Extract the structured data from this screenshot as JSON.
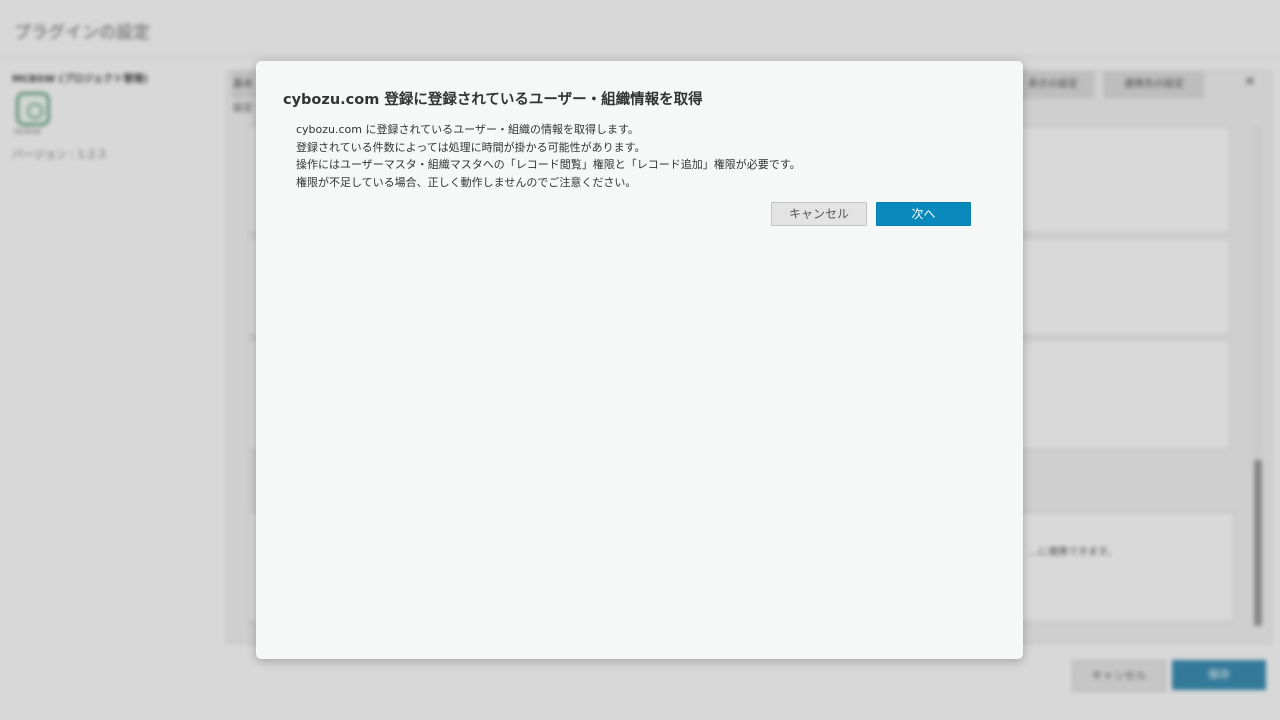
{
  "background": {
    "page_title": "プラグインの設定",
    "plugin_name": "MCBSW (プロジェクト管理)",
    "plugin_icon_caption": "MCBSW",
    "version": "バージョン : 1.2.3",
    "tabs": [
      "基本設定",
      "...",
      "表示の設定",
      "連携先の設定"
    ],
    "footer": {
      "cancel_label": "キャンセル",
      "save_label": "保存"
    },
    "card_text": "...に連携できます。"
  },
  "dialog": {
    "title": "cybozu.com 登録に登録されているユーザー・組織情報を取得",
    "lines": [
      "cybozu.com に登録されているユーザー・組織の情報を取得します。",
      "登録されている件数によっては処理に時間が掛かる可能性があります。",
      "操作にはユーザーマスタ・組織マスタへの「レコード閲覧」権限と「レコード追加」権限が必要です。",
      "権限が不足している場合、正しく動作しませんのでご注意ください。"
    ],
    "cancel_label": "キャンセル",
    "next_label": "次へ"
  },
  "colors": {
    "primary": "#0a89bd",
    "dialog_bg": "#f6f8f8",
    "text": "#333333"
  }
}
